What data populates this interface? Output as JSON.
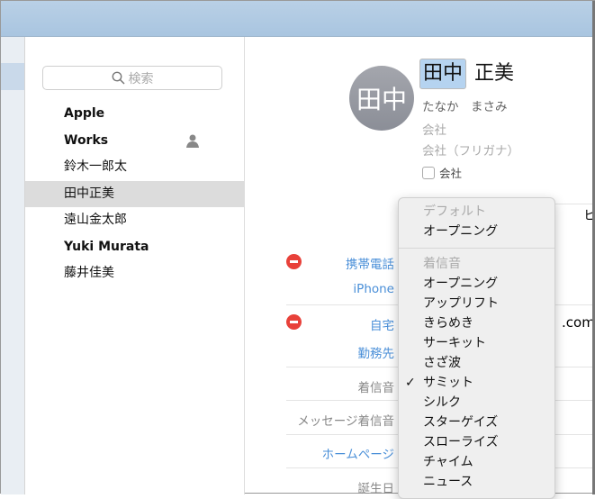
{
  "search": {
    "placeholder": "検索"
  },
  "contacts": [
    {
      "name": "Apple",
      "bold": true
    },
    {
      "name": "Works",
      "bold": true,
      "icon": "person-icon"
    },
    {
      "name": "鈴木一郎太"
    },
    {
      "name": "田中正美",
      "selected": true
    },
    {
      "name": "遠山金太郎"
    },
    {
      "name": "Yuki Murata",
      "bold": true
    },
    {
      "name": "藤井佳美"
    }
  ],
  "card": {
    "avatar": "田中",
    "last_name": "田中",
    "first_name": "正美",
    "reading": "たなか　まさみ",
    "company_placeholder": "会社",
    "company_kana_placeholder": "会社（フリガナ）",
    "company_checkbox": "会社",
    "partial_right": "ヒ",
    "partial_email": ".com"
  },
  "fields": {
    "mobile": "携帯電話",
    "iphone": "iPhone",
    "home": "自宅",
    "work": "勤務先",
    "ringtone": "着信音",
    "message_tone": "メッセージ着信音",
    "homepage": "ホームページ",
    "birthday": "誕生日"
  },
  "menu": {
    "default_header": "デフォルト",
    "default_item": "オープニング",
    "ringtone_header": "着信音",
    "items": [
      "オープニング",
      "アップリフト",
      "きらめき",
      "サーキット",
      "さざ波",
      "サミット",
      "シルク",
      "スターゲイズ",
      "スローライズ",
      "チャイム",
      "ニュース"
    ],
    "checked": "サミット"
  },
  "colors": {
    "accent": "#4a8fd8",
    "delete": "#e8413a"
  }
}
